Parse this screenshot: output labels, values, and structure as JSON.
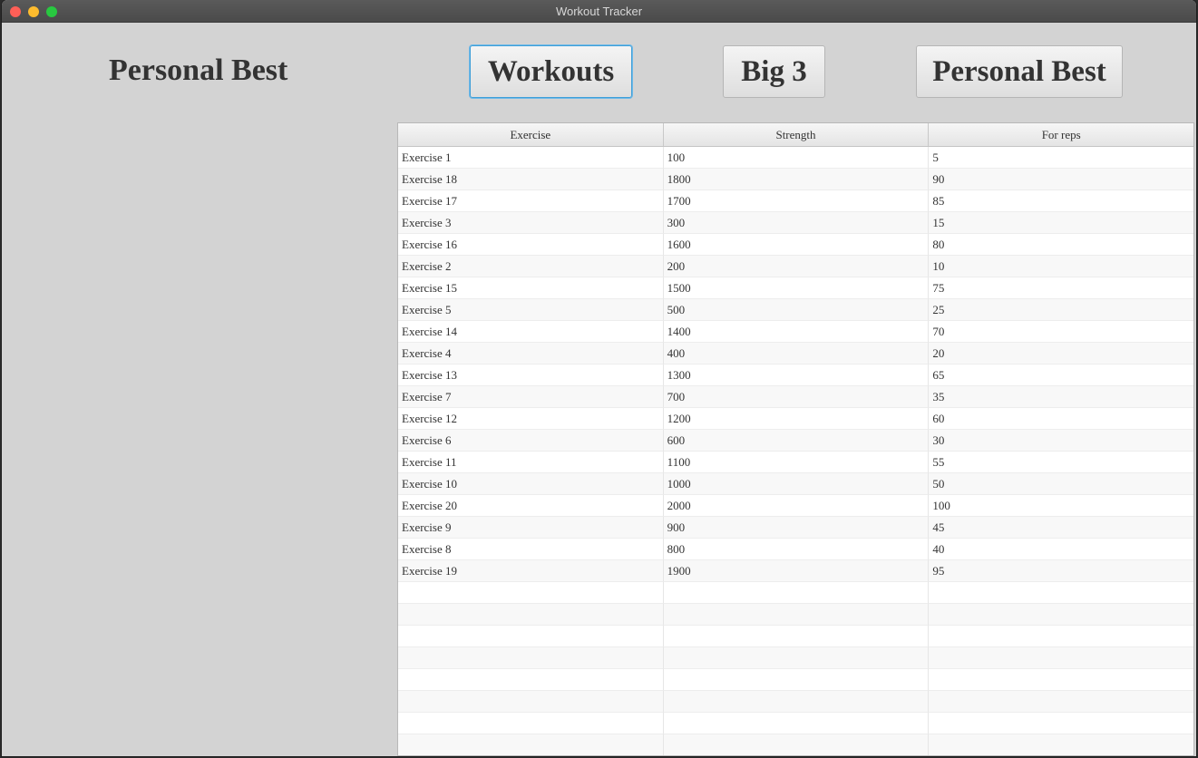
{
  "window": {
    "title": "Workout Tracker"
  },
  "page": {
    "title": "Personal Best"
  },
  "nav": {
    "workouts_label": "Workouts",
    "big3_label": "Big 3",
    "personal_best_label": "Personal Best"
  },
  "table": {
    "columns": [
      "Exercise",
      "Strength",
      "For reps"
    ],
    "rows": [
      [
        "Exercise 1",
        "100",
        "5"
      ],
      [
        "Exercise 18",
        "1800",
        "90"
      ],
      [
        "Exercise 17",
        "1700",
        "85"
      ],
      [
        "Exercise 3",
        "300",
        "15"
      ],
      [
        "Exercise 16",
        "1600",
        "80"
      ],
      [
        "Exercise 2",
        "200",
        "10"
      ],
      [
        "Exercise 15",
        "1500",
        "75"
      ],
      [
        "Exercise 5",
        "500",
        "25"
      ],
      [
        "Exercise 14",
        "1400",
        "70"
      ],
      [
        "Exercise 4",
        "400",
        "20"
      ],
      [
        "Exercise 13",
        "1300",
        "65"
      ],
      [
        "Exercise 7",
        "700",
        "35"
      ],
      [
        "Exercise 12",
        "1200",
        "60"
      ],
      [
        "Exercise 6",
        "600",
        "30"
      ],
      [
        "Exercise 11",
        "1100",
        "55"
      ],
      [
        "Exercise 10",
        "1000",
        "50"
      ],
      [
        "Exercise 20",
        "2000",
        "100"
      ],
      [
        "Exercise 9",
        "900",
        "45"
      ],
      [
        "Exercise 8",
        "800",
        "40"
      ],
      [
        "Exercise 19",
        "1900",
        "95"
      ]
    ]
  },
  "colors": {
    "window_bg": "#d3d3d3",
    "focus_ring": "#3f9fd8",
    "text": "#333333"
  }
}
